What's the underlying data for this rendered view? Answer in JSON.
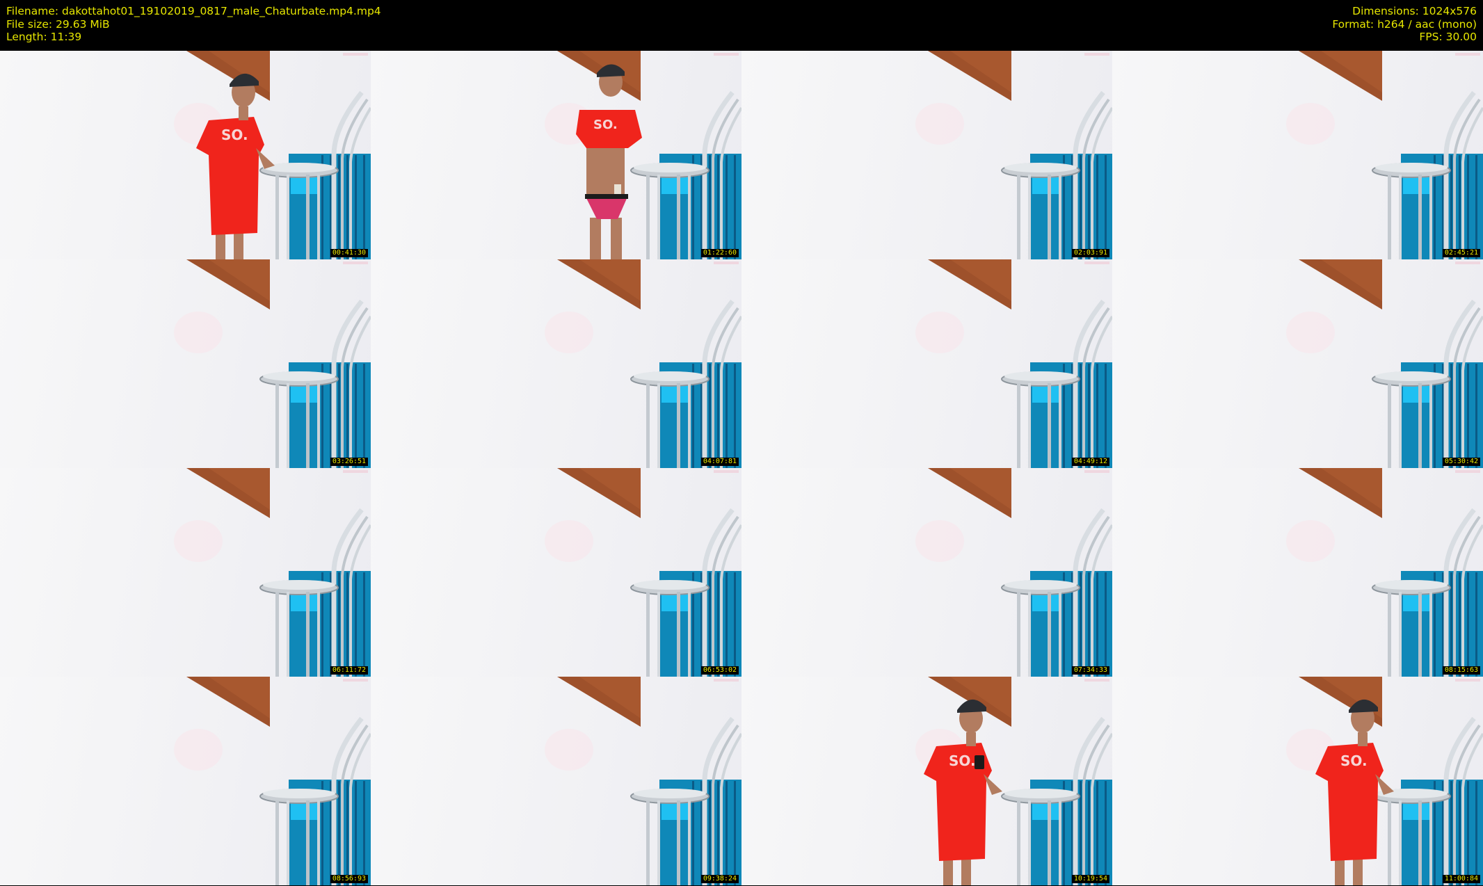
{
  "header": {
    "filename": "Filename: dakottahot01_19102019_0817_male_Chaturbate.mp4.mp4",
    "filesize": "File size: 29.63 MiB",
    "length": "Length: 11:39",
    "dimensions": "Dimensions: 1024x576",
    "format": "Format: h264 / aac (mono)",
    "fps": "FPS: 30.00"
  },
  "colors": {
    "header_text": "#e6e600",
    "header_bg": "#000000",
    "shirt_red": "#f0241c",
    "cabinet_brown": "#a8582f",
    "chair_blue": "#0f88b8"
  },
  "thumbnails": [
    {
      "timestamp": "00:41:30",
      "person": "standing-shirt"
    },
    {
      "timestamp": "01:22:60",
      "person": "shirt-lifted"
    },
    {
      "timestamp": "02:03:91",
      "person": "none"
    },
    {
      "timestamp": "02:45:21",
      "person": "none"
    },
    {
      "timestamp": "03:26:51",
      "person": "none"
    },
    {
      "timestamp": "04:07:81",
      "person": "none"
    },
    {
      "timestamp": "04:49:12",
      "person": "none"
    },
    {
      "timestamp": "05:30:42",
      "person": "none"
    },
    {
      "timestamp": "06:11:72",
      "person": "none"
    },
    {
      "timestamp": "06:53:02",
      "person": "none"
    },
    {
      "timestamp": "07:34:33",
      "person": "none"
    },
    {
      "timestamp": "08:15:63",
      "person": "none"
    },
    {
      "timestamp": "08:56:93",
      "person": "none"
    },
    {
      "timestamp": "09:38:24",
      "person": "none"
    },
    {
      "timestamp": "10:19:54",
      "person": "phone"
    },
    {
      "timestamp": "11:00:84",
      "person": "leaning"
    }
  ]
}
